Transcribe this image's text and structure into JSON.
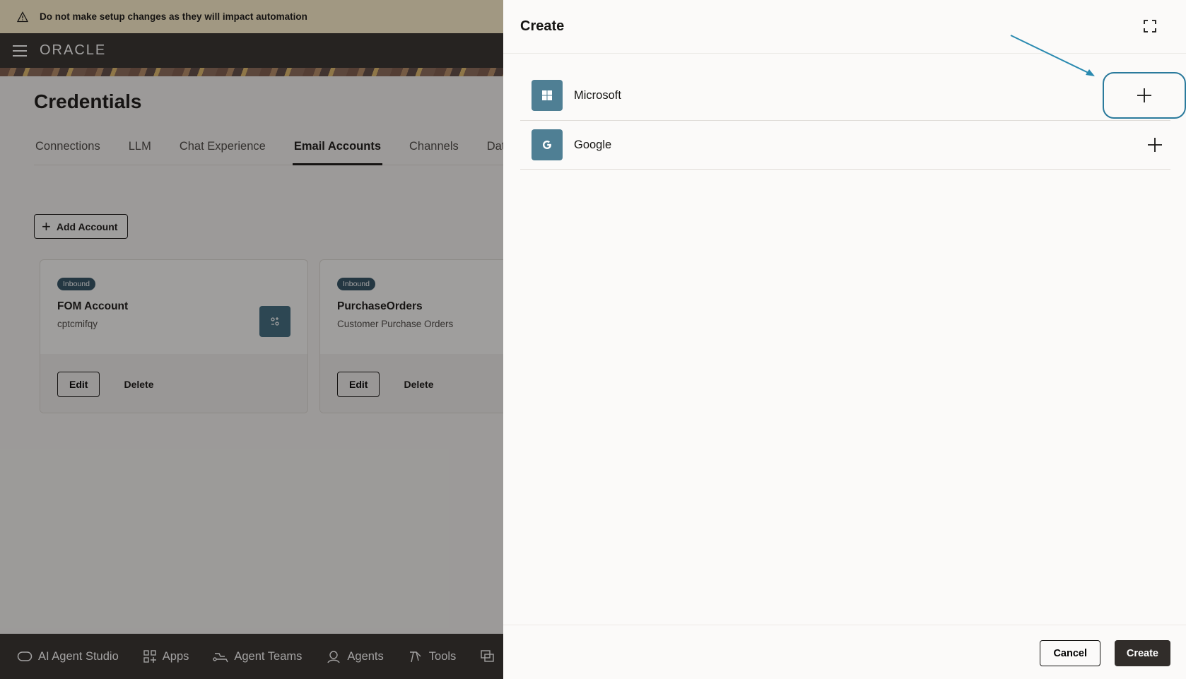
{
  "warning_banner": {
    "text": "Do not make setup changes as they will impact automation"
  },
  "header": {
    "logo_text": "ORACLE"
  },
  "page": {
    "title": "Credentials"
  },
  "tabs": [
    {
      "label": "Connections",
      "active": false
    },
    {
      "label": "LLM",
      "active": false
    },
    {
      "label": "Chat Experience",
      "active": false
    },
    {
      "label": "Email Accounts",
      "active": true
    },
    {
      "label": "Channels",
      "active": false
    },
    {
      "label": "Data S",
      "active": false
    }
  ],
  "toolbar": {
    "add_account_label": "Add Account"
  },
  "cards": [
    {
      "badge": "Inbound",
      "title": "FOM Account",
      "subtitle": "cptcmifqy",
      "edit_label": "Edit",
      "delete_label": "Delete"
    },
    {
      "badge": "Inbound",
      "title": "PurchaseOrders",
      "subtitle": "Customer Purchase Orders",
      "edit_label": "Edit",
      "delete_label": "Delete"
    }
  ],
  "bottom_nav": [
    {
      "label": "AI Agent Studio",
      "icon": "studio-icon"
    },
    {
      "label": "Apps",
      "icon": "apps-grid-icon"
    },
    {
      "label": "Agent Teams",
      "icon": "agent-teams-icon"
    },
    {
      "label": "Agents",
      "icon": "agent-icon"
    },
    {
      "label": "Tools",
      "icon": "tools-icon"
    }
  ],
  "drawer": {
    "title": "Create",
    "providers": [
      {
        "name": "Microsoft",
        "icon": "windows-icon"
      },
      {
        "name": "Google",
        "icon": "google-icon"
      }
    ],
    "cancel_label": "Cancel",
    "create_label": "Create"
  },
  "colors": {
    "accent": "#2a7a9c",
    "dark": "#312d2a",
    "badge": "#2d4f62"
  }
}
